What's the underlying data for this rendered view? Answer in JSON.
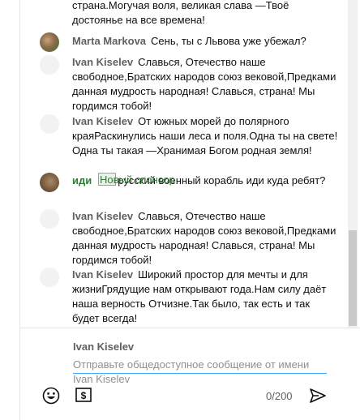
{
  "messages": [
    {
      "author": "",
      "text": "страна.Могучая воля, великая слава —Твоё достоянье на все времена!"
    },
    {
      "author": "Marta Markova",
      "text": "Сень, ты с Львова уже убежал?"
    },
    {
      "author": "Ivan Kiselev",
      "text": "Славься, Отечество наше свободное,Братских народов союз вековой,Предками данная мудрость народная! Славься, страна! Мы гордимся тобой!"
    },
    {
      "author": "Ivan Kiselev",
      "text": "От южных морей до полярного краяРаскинулись наши леса и поля.Одна ты на свете! Одна ты такая —Хранимая Богом родная земля!"
    },
    {
      "author": "иди",
      "sponsor_alt": "Новый спонсор",
      "text": "русский военный корабль иди куда ребят?"
    },
    {
      "author": "Ivan Kiselev",
      "text": "Славься, Отечество наше свободное,Братских народов союз вековой,Предками данная мудрость народная! Славься, страна! Мы гордимся тобой!"
    },
    {
      "author": "Ivan Kiselev",
      "text": "Широкий простор для мечты и для жизниГрядущие нам открывают года.Нам силу даёт наша верность Отчизне.Так было, так есть и так будет всегда!"
    }
  ],
  "composer": {
    "author": "Ivan Kiselev",
    "placeholder_line1": "Отправьте общедоступное сообщение от имени",
    "placeholder_line2": "Ivan Kiselev",
    "counter": "0/200",
    "icons": [
      "emoji-icon",
      "super-chat-dollar-icon",
      "send-icon"
    ]
  },
  "colors": {
    "accent": "#3ea6ff",
    "sponsor_green": "#2e7d32",
    "muted": "#606060"
  }
}
